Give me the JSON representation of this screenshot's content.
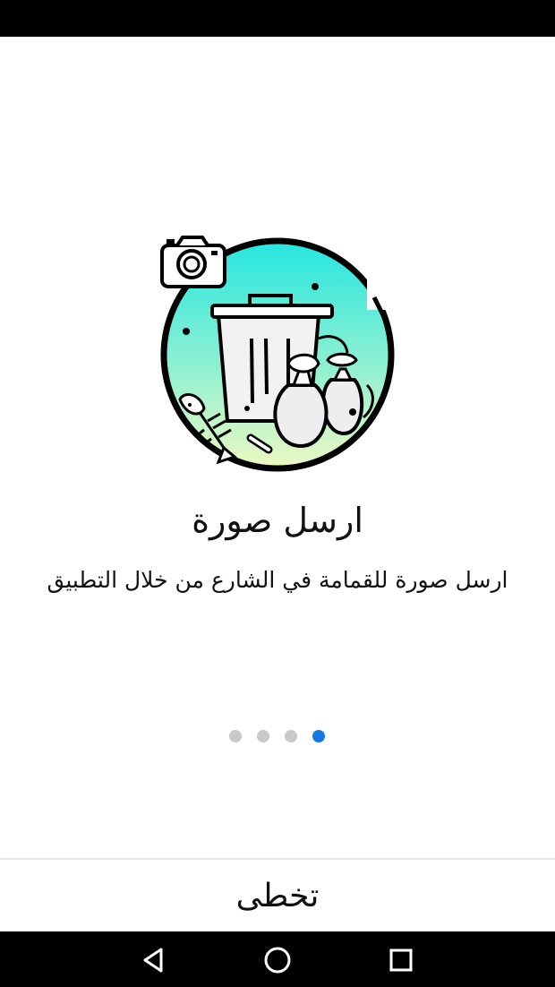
{
  "onboarding": {
    "title": "ارسل صورة",
    "subtitle": "ارسل صورة للقمامة في الشارع من خلال التطبيق",
    "illustration_icon": "trash-bin-camera-illustration",
    "page_count": 4,
    "active_page": 4
  },
  "pager": {
    "active_color": "#1677e6",
    "inactive_color": "#c9c9c9"
  },
  "footer": {
    "skip_label": "تخطى"
  },
  "navigation_bar": {
    "buttons": [
      "back-icon",
      "home-icon",
      "recents-icon"
    ]
  }
}
